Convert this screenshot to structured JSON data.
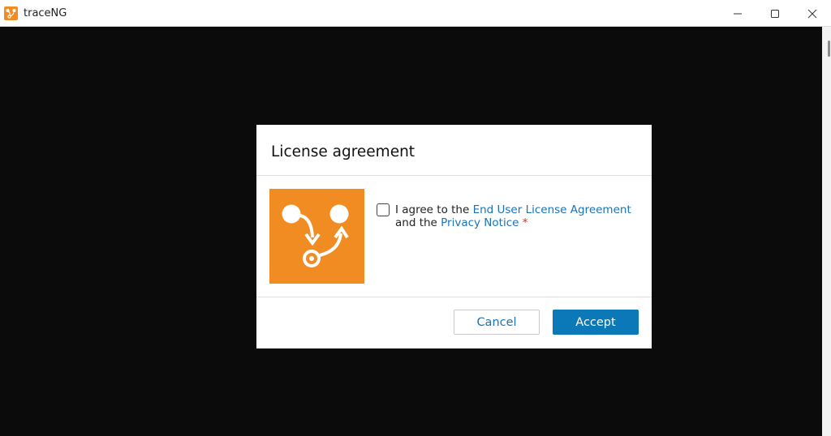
{
  "window": {
    "title": "traceNG",
    "app_icon": "traceng-logo-icon",
    "controls": {
      "minimize_icon": "minimize-icon",
      "maximize_icon": "maximize-icon",
      "close_icon": "close-icon"
    }
  },
  "dialog": {
    "title": "License agreement",
    "logo_icon": "traceng-route-icon",
    "agreement": {
      "prefix": "I agree to the ",
      "eula_link": "End User License Agreement",
      "middle": "and the ",
      "privacy_link": "Privacy Notice",
      "required_marker": "*"
    },
    "buttons": {
      "cancel_label": "Cancel",
      "accept_label": "Accept"
    }
  },
  "colors": {
    "brand_orange": "#f08c22",
    "accent_blue": "#0b78b8",
    "link_blue": "#1a73b8",
    "required_red": "#d32f2f",
    "background_dark": "#0b0b0b"
  }
}
